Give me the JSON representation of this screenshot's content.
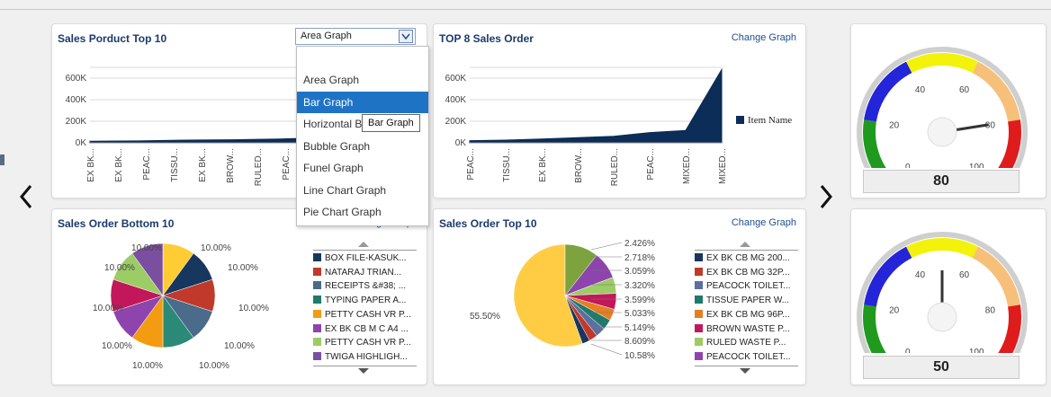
{
  "panels": {
    "top10": {
      "title": "Sales Porduct Top 10",
      "dropdown_value": "Area Graph",
      "menu_items": [
        "Area Graph",
        "Bar Graph",
        "Horizontal B",
        "Bubble Graph",
        "Funel Graph",
        "Line Chart Graph",
        "Pie Chart Graph"
      ],
      "selected_item": "Bar Graph",
      "tooltip": "Bar Graph"
    },
    "top8": {
      "title": "TOP 8 Sales Order",
      "link": "Change Graph",
      "legend": "Item Name"
    },
    "bottom10": {
      "title": "Sales Order Bottom 10",
      "link": "Change Graph",
      "legend": [
        "BOX FILE-KASUK...",
        "NATARAJ TRIAN...",
        "RECEIPTS &#38; ...",
        "TYPING PAPER A...",
        "PETTY CASH VR P...",
        "EX BK CB M C A4 ...",
        "PETTY CASH VR P...",
        "TWIGA HIGHLIGH..."
      ]
    },
    "top10orders": {
      "title": "Sales Order Top 10",
      "link": "Change Graph",
      "legend": [
        "EX BK CB MG 200...",
        "EX BK CB MG 32P...",
        "PEACOCK TOILET...",
        "TISSUE PAPER W...",
        "EX BK CB MG 96P...",
        "BROWN WASTE P...",
        "RULED WASTE P...",
        "PEACOCK TOILET..."
      ]
    }
  },
  "gauges": [
    {
      "value": "80"
    },
    {
      "value": "50"
    }
  ],
  "chart_data": [
    {
      "type": "area",
      "title": "Sales Porduct Top 10",
      "categories": [
        "EX BK...",
        "EX BK...",
        "PEAC...",
        "TISSU...",
        "EX BK...",
        "BROW...",
        "RULED...",
        "PEAC..."
      ],
      "values": [
        15000,
        18000,
        25000,
        28000,
        35000,
        48000,
        60000,
        120000
      ],
      "ylim": [
        0,
        700000
      ],
      "yticks": [
        "0K",
        "200K",
        "400K",
        "600K"
      ],
      "color": "#0b2d57"
    },
    {
      "type": "area",
      "title": "TOP 8 Sales Order",
      "categories": [
        "PEAC...",
        "TISSU...",
        "EX BK...",
        "BROW...",
        "RULED...",
        "PEAC...",
        "MIXED...",
        "MIXED..."
      ],
      "series": [
        {
          "name": "Item Name",
          "values": [
            20000,
            25000,
            35000,
            48000,
            60000,
            95000,
            115000,
            680000
          ]
        }
      ],
      "ylim": [
        0,
        700000
      ],
      "yticks": [
        "0K",
        "200K",
        "400K",
        "600K"
      ],
      "color": "#0b2d57"
    },
    {
      "type": "pie",
      "title": "Sales Order Bottom 10",
      "labels": [
        "10.00%",
        "10.00%",
        "10.00%",
        "10.00%",
        "10.00%",
        "10.00%",
        "10.00%",
        "10.00%",
        "10.00%",
        "10.00%"
      ],
      "values": [
        10,
        10,
        10,
        10,
        10,
        10,
        10,
        10,
        10,
        10
      ],
      "colors": [
        "#ffcc33",
        "#17375e",
        "#c0392b",
        "#4a6b8a",
        "#2b8a77",
        "#f39c12",
        "#8e44ad",
        "#c2185b",
        "#9ccc65",
        "#7b4fa0"
      ]
    },
    {
      "type": "pie",
      "title": "Sales Order Top 10",
      "labels": [
        "55.50%",
        "10.58%",
        "8.609%",
        "5.149%",
        "5.033%",
        "3.599%",
        "3.320%",
        "3.059%",
        "2.718%",
        "2.426%"
      ],
      "values": [
        55.5,
        10.58,
        8.609,
        5.149,
        5.033,
        3.599,
        3.32,
        3.059,
        2.718,
        2.426
      ],
      "colors": [
        "#ffcc44",
        "#7ca33e",
        "#8e44ad",
        "#9ccc65",
        "#c2185b",
        "#e67e22",
        "#1f7a6b",
        "#5b6fa0",
        "#c0392b",
        "#17375e"
      ]
    },
    {
      "type": "gauge",
      "value": 80,
      "min": 0,
      "max": 100,
      "ticks": [
        "0",
        "20",
        "40",
        "60",
        "80",
        "100"
      ]
    },
    {
      "type": "gauge",
      "value": 50,
      "min": 0,
      "max": 100,
      "ticks": [
        "0",
        "20",
        "40",
        "60",
        "80",
        "100"
      ]
    }
  ]
}
